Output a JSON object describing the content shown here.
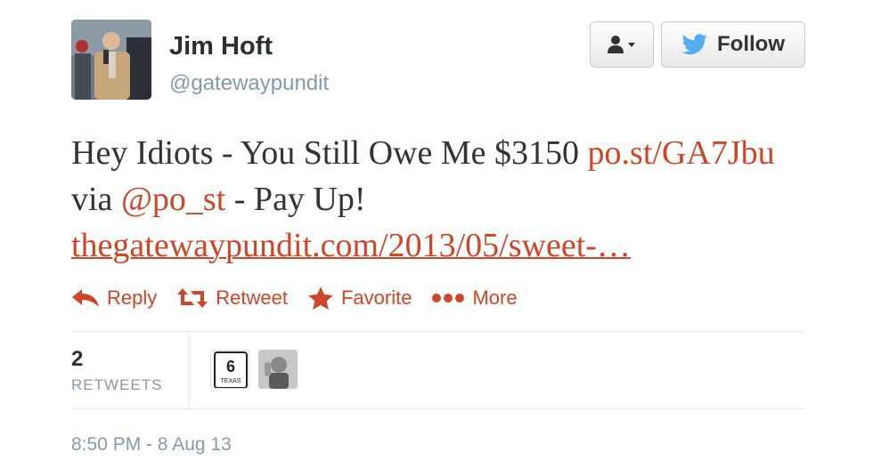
{
  "author": {
    "name": "Jim Hoft",
    "handle": "@gatewaypundit"
  },
  "header_buttons": {
    "follow_label": "Follow",
    "user_menu_icon": "user-dropdown-icon"
  },
  "tweet": {
    "text_part1": "Hey Idiots - You Still Owe Me $3150 ",
    "link1": "po.st/GA7Jbu",
    "text_part2": " via ",
    "mention": "@po_st",
    "text_part3": " - Pay Up! ",
    "link2": "thegatewaypundit.com/2013/05/sweet-…"
  },
  "actions": [
    {
      "label": "Reply",
      "icon": "reply-icon"
    },
    {
      "label": "Retweet",
      "icon": "retweet-icon"
    },
    {
      "label": "Favorite",
      "icon": "star-icon"
    },
    {
      "label": "More",
      "icon": "more-dots-icon"
    }
  ],
  "stats": {
    "retweet_count": "2",
    "retweet_label": "RETWEETS",
    "retweeter_badge_number": "6",
    "retweeter_badge_text": "TEXAS"
  },
  "timestamp": "8:50 PM - 8 Aug 13",
  "colors": {
    "link": "#d04526",
    "muted": "#8899a6",
    "twitter_blue": "#55acee"
  }
}
